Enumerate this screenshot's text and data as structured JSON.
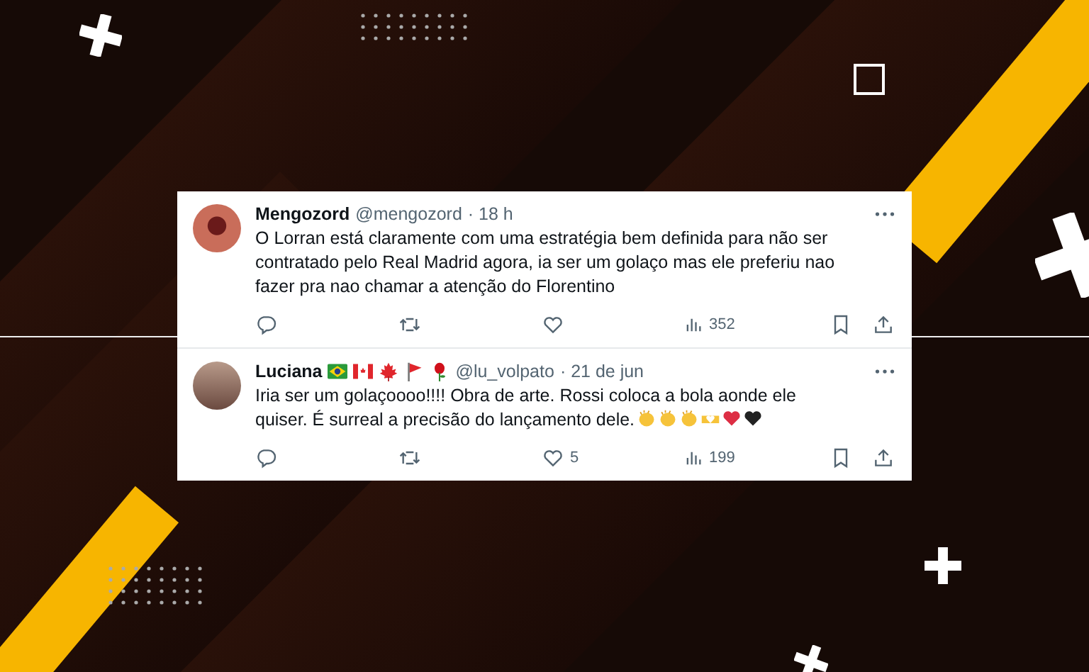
{
  "tweets": [
    {
      "name": "Mengozord",
      "handle": "@mengozord",
      "time": "· 18 h",
      "text": "O Lorran está claramente com uma estratégia bem definida para não ser contratado pelo Real Madrid agora, ia ser um golaço mas ele preferiu nao fazer pra nao chamar a atenção do Florentino",
      "avatar": {
        "kind": "drawing"
      },
      "views": "352"
    },
    {
      "name": "Luciana",
      "handle": "@lu_volpato",
      "time": "· 21 de jun",
      "text": "Iria ser um golaçoooo!!!! Obra de arte. Rossi coloca a bola aonde ele quiser. É surreal a precisão do lançamento dele.",
      "avatar": {
        "kind": "photo"
      },
      "name_emoji": [
        {
          "kind": "brazil"
        },
        {
          "kind": "canada"
        },
        {
          "kind": "maple"
        },
        {
          "kind": "flag"
        },
        {
          "kind": "rose"
        }
      ],
      "text_emoji": [
        {
          "kind": "clap"
        },
        {
          "kind": "clap"
        },
        {
          "kind": "clap"
        },
        {
          "kind": "hands"
        },
        {
          "kind": "heart"
        },
        {
          "kind": "heart-dark"
        }
      ],
      "likes": "5",
      "views": "199"
    }
  ]
}
